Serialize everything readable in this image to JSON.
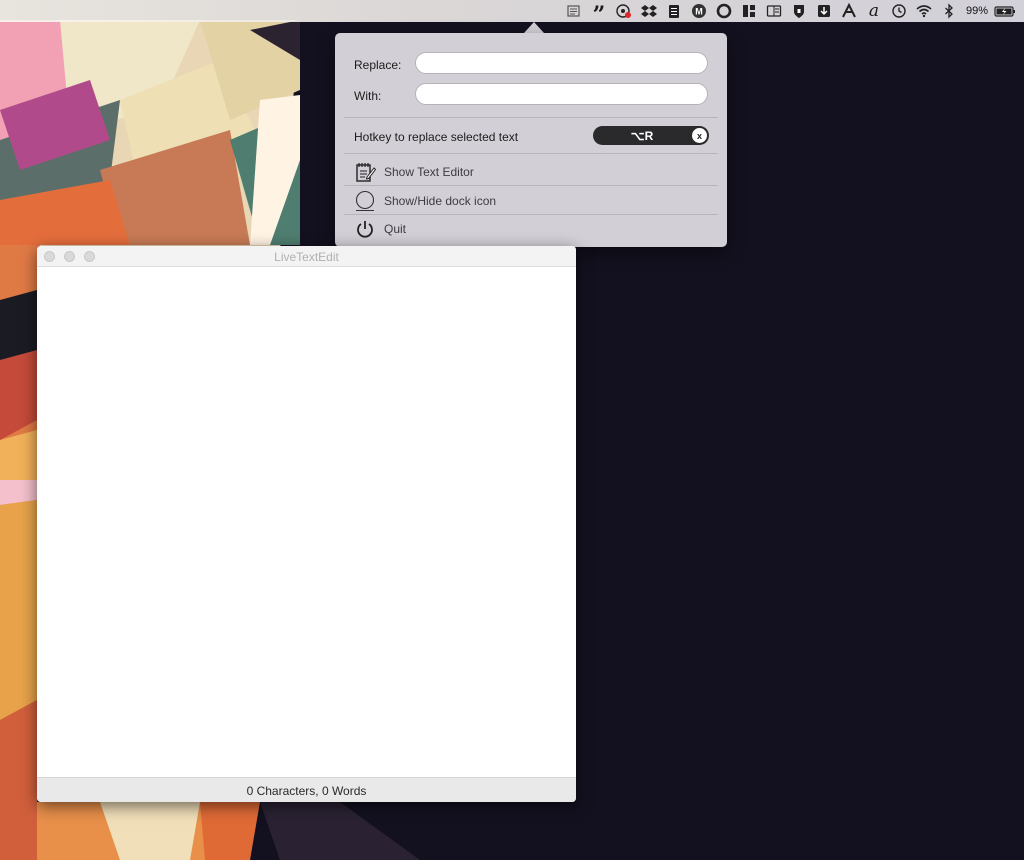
{
  "menubar": {
    "icons": [
      "livetextedit-icon",
      "quote-icon",
      "screen-record-icon",
      "dropbox-icon",
      "clipboard-icon",
      "m-icon",
      "circle-icon",
      "layout-icon",
      "window-icon",
      "lock-icon",
      "download-icon",
      "a-mark-icon",
      "script-a-icon",
      "time-machine-icon",
      "wifi-icon",
      "bluetooth-icon",
      "battery-icon"
    ],
    "battery_percent": "99%"
  },
  "popover": {
    "replace_label": "Replace:",
    "replace_value": "",
    "with_label": "With:",
    "with_value": "",
    "hotkey_label": "Hotkey to replace selected text",
    "hotkey_value": "⌥R",
    "hotkey_clear": "x",
    "menu": [
      {
        "label": "Show Text Editor",
        "icon": "notepad-icon"
      },
      {
        "label": "Show/Hide dock icon",
        "icon": "circle-outline-icon"
      },
      {
        "label": "Quit",
        "icon": "power-icon"
      }
    ]
  },
  "window": {
    "title": "LiveTextEdit",
    "content": "",
    "status": "0 Characters, 0 Words"
  }
}
